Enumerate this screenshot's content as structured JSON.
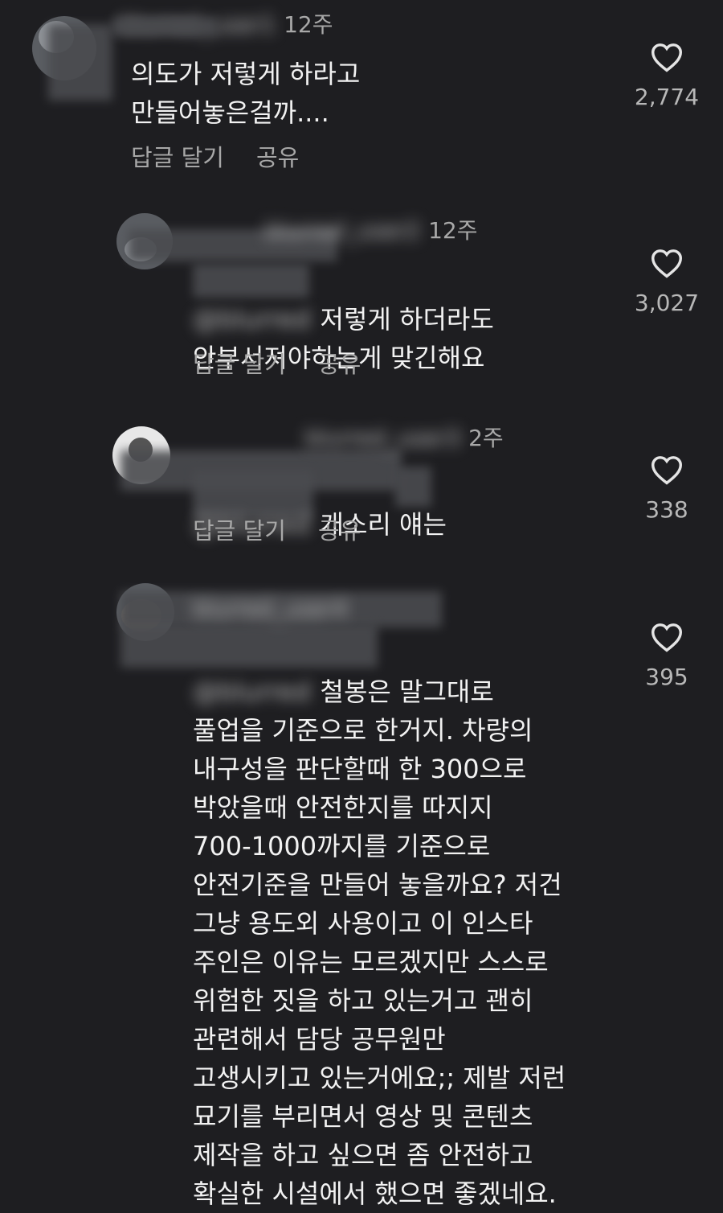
{
  "comments": [
    {
      "username": "blurred_user1",
      "time": "12주",
      "text": "의도가 저렇게 하라고\n만들어놓은걸까....",
      "mention": "",
      "reply_label": "답글 달기",
      "share_label": "공유",
      "likes": "2,774"
    },
    {
      "username": "blurred_user2",
      "time": "12주",
      "mention": "@blurred",
      "text": "저렇게 하더라도\n안부서져야하는게 맞긴해요",
      "reply_label": "답글 달기",
      "share_label": "공유",
      "likes": "3,027"
    },
    {
      "username": "blurred_user3",
      "time": "2주",
      "mention": "@blurred",
      "text": "개소리 얘는",
      "reply_label": "답글 달기",
      "share_label": "공유",
      "likes": "338"
    },
    {
      "username": "blurred_user4",
      "time": "",
      "mention": "@blurred",
      "text": "철봉은 말그대로\n풀업을 기준으로 한거지. 차량의\n내구성을 판단할때 한 300으로\n박았을때 안전한지를 따지지\n700-1000까지를 기준으로\n안전기준을 만들어 놓을까요? 저건\n그냥 용도외 사용이고 이 인스타\n주인은 이유는 모르겠지만 스스로\n위험한 짓을 하고 있는거고 괜히\n관련해서 담당 공무원만\n고생시키고 있는거에요;; 제발 저런\n묘기를 부리면서 영상 및 콘텐츠\n제작을 하고 싶으면 좀 안전하고\n확실한 시설에서 했으면 좋겠네요.",
      "reply_label": "",
      "share_label": "",
      "likes": "395"
    }
  ],
  "icons": {
    "like": "heart-outline-icon"
  },
  "colors": {
    "background": "#1e1e21",
    "text": "#f2f2f2",
    "secondary": "#a8a8a8"
  }
}
